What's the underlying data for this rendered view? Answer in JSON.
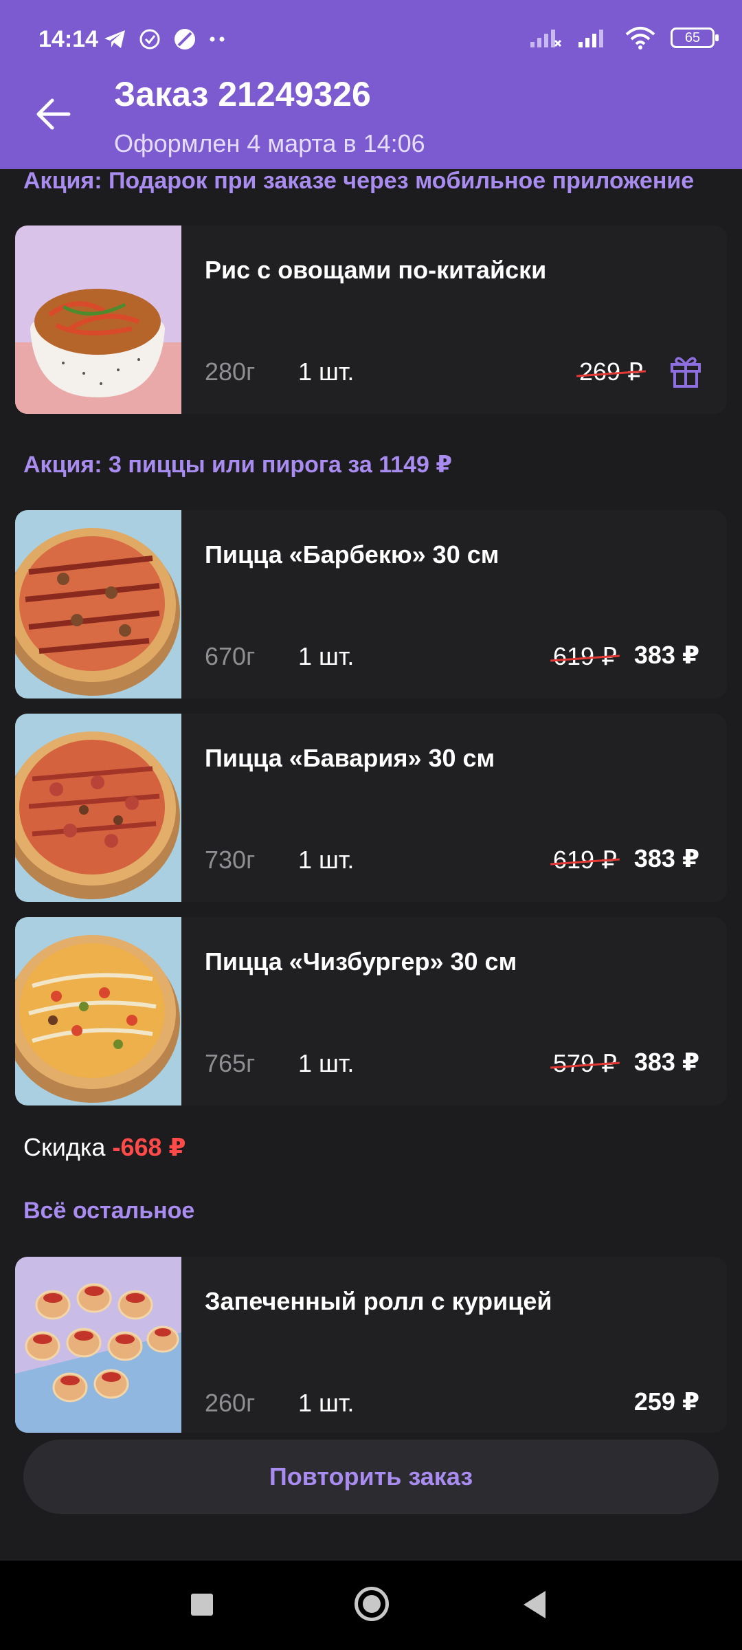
{
  "status_bar": {
    "time": "14:14",
    "battery": "65",
    "left_icons": [
      "telegram-icon",
      "check-circle-icon",
      "app-icon",
      "more-dots-icon"
    ],
    "right_icons": [
      "signal-off-icon",
      "signal-icon",
      "wifi-icon",
      "battery-icon"
    ]
  },
  "header": {
    "title": "Заказ 21249326",
    "subtitle": "Оформлен 4 марта в 14:06"
  },
  "sections": [
    {
      "title": "Акция: Подарок при заказе через мобильное приложение",
      "items": [
        {
          "name": "Рис с овощами по-китайски",
          "weight": "280г",
          "qty": "1 шт.",
          "old_price": "269 ₽",
          "new_price": "",
          "gift": true
        }
      ]
    },
    {
      "title": "Акция: 3 пиццы или пирога за 1149 ₽",
      "items": [
        {
          "name": "Пицца «Барбекю» 30 см",
          "weight": "670г",
          "qty": "1 шт.",
          "old_price": "619 ₽",
          "new_price": "383 ₽"
        },
        {
          "name": "Пицца «Бавария» 30 см",
          "weight": "730г",
          "qty": "1 шт.",
          "old_price": "619 ₽",
          "new_price": "383 ₽"
        },
        {
          "name": "Пицца «Чизбургер» 30 см",
          "weight": "765г",
          "qty": "1 шт.",
          "old_price": "579 ₽",
          "new_price": "383 ₽"
        }
      ]
    },
    {
      "title": "Всё остальное",
      "items": [
        {
          "name": "Запеченный ролл с курицей",
          "weight": "260г",
          "qty": "1 шт.",
          "old_price": "",
          "new_price": "259 ₽"
        }
      ]
    }
  ],
  "discount": {
    "label": "Скидка",
    "value": "-668 ₽"
  },
  "repeat_button": "Повторить заказ",
  "colors": {
    "accent": "#7c5bd1",
    "accent_text": "#a98cf0",
    "discount": "#ff4a4a",
    "background": "#1c1c1e"
  }
}
